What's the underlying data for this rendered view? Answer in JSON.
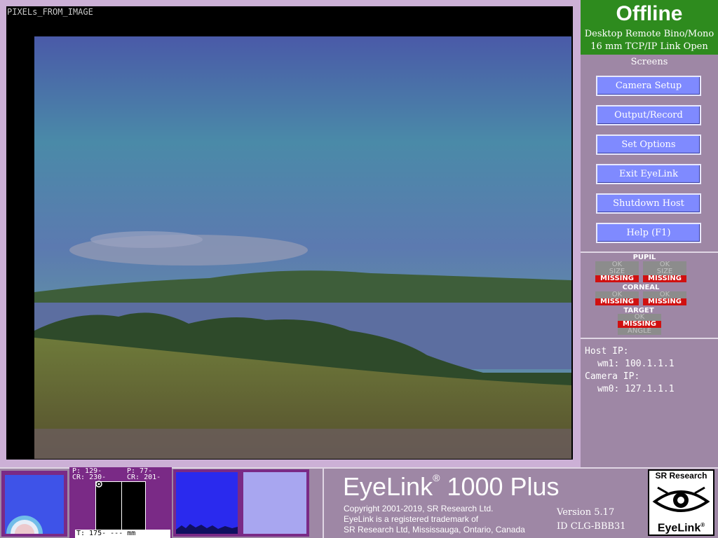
{
  "display": {
    "label": "PIXELs_FROM_IMAGE"
  },
  "status": {
    "title": "Offline",
    "mode": "Desktop Remote Bino/Mono",
    "link": "16 mm TCP/IP Link Open",
    "color": "#2e8b1e"
  },
  "screens": {
    "heading": "Screens",
    "buttons": [
      "Camera Setup",
      "Output/Record",
      "Set Options",
      "Exit EyeLink",
      "Shutdown Host",
      "Help (F1)"
    ]
  },
  "indicators": {
    "pupil_heading": "PUPIL",
    "corneal_heading": "CORNEAL",
    "target_heading": "TARGET",
    "ok": "OK",
    "size": "SIZE",
    "missing": "MISSING",
    "angle": "ANGLE",
    "missing_color": "#d01010"
  },
  "network": {
    "host_label": "Host IP:",
    "host_value": "wm1: 100.1.1.1",
    "camera_label": "Camera IP:",
    "camera_value": "wm0: 127.1.1.1"
  },
  "pcr": {
    "left_p": "P:  129-",
    "left_cr": "CR: 230-",
    "right_p": "P:   77-",
    "right_cr": "CR: 201-",
    "threshold": "T: 175-     ---  mm"
  },
  "product": {
    "name": "EyeLink",
    "reg": "®",
    "suffix": "1000 Plus",
    "copyright_lines": [
      "Copyright 2001-2019, SR Research Ltd.",
      "EyeLink is a registered trademark of",
      "SR Research Ltd, Mississauga, Ontario, Canada"
    ],
    "version": "Version 5.17",
    "id": "ID CLG-BBB31"
  },
  "logo": {
    "top": "SR Research",
    "bottom": "EyeLink",
    "reg": "®",
    "icon": "eye-logo-icon"
  }
}
